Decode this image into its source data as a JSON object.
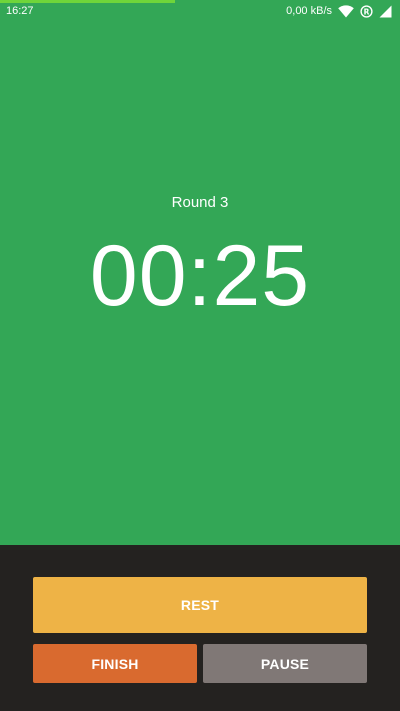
{
  "status_bar": {
    "time": "16:27",
    "network_speed": "0,00 kB/s",
    "icons": [
      "wifi-icon",
      "registered-icon",
      "signal-icon"
    ]
  },
  "timer": {
    "round_label": "Round 3",
    "value": "00:25",
    "background_color": "#33a756",
    "progress_color": "#6fd53a"
  },
  "controls": {
    "rest_label": "REST",
    "finish_label": "FINISH",
    "pause_label": "PAUSE",
    "colors": {
      "rest": "#eeb346",
      "finish": "#d96a2f",
      "pause": "#807876",
      "panel": "#242220"
    }
  }
}
